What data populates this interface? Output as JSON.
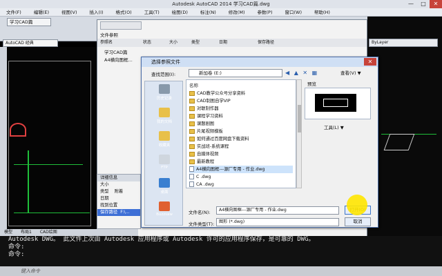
{
  "app": {
    "title": "Autodesk AutoCAD 2014    学习CAD篇.dwg",
    "window_controls": [
      "—",
      "□",
      "✕"
    ]
  },
  "menu": [
    "文件(F)",
    "编辑(E)",
    "视图(V)",
    "插入(I)",
    "格式(O)",
    "工具(T)",
    "绘图(D)",
    "标注(N)",
    "修改(M)",
    "参数(P)",
    "窗口(W)",
    "帮助(H)"
  ],
  "doc_tab": "学习CAD篇",
  "workspace": "AutoCAD 经典",
  "layer_combo": "ByLayer",
  "background_window": {
    "section": "文件参照",
    "columns": [
      "参照名",
      "状态",
      "大小",
      "类型",
      "日期",
      "保存路径"
    ],
    "rows": [
      "学习CAD篇",
      "A4横向图框..."
    ]
  },
  "details": {
    "header": "详细信息",
    "fields": [
      "大小",
      "类型",
      "日期",
      "找到位置",
      "保存路径"
    ],
    "type_value": "附着",
    "path_value": "F:\\..."
  },
  "dialog": {
    "title": "选择参照文件",
    "lookin_label": "查找范围(I):",
    "lookin_value": "新加卷 (E:)",
    "nav_icons": "◀ ▲ ✕ ▦",
    "view_label": "查看(V) ▼",
    "tools_label": "工具(L) ▼",
    "list_header": "名称",
    "preview_label": "预览",
    "places": [
      "历史记录",
      "我的文档",
      "收藏夹",
      "FTP",
      "桌面",
      "Buzzsaw"
    ],
    "files": [
      {
        "name": "CAD教学公众号分享资料",
        "kind": "folder"
      },
      {
        "name": "CAD制图自学VIP",
        "kind": "folder"
      },
      {
        "name": "对联制作器",
        "kind": "folder"
      },
      {
        "name": "课程学习资料",
        "kind": "folder"
      },
      {
        "name": "课题剧图",
        "kind": "folder"
      },
      {
        "name": "片尾视频模板",
        "kind": "folder"
      },
      {
        "name": "如何通过百度网盘下载资料",
        "kind": "folder"
      },
      {
        "name": "实战班-系统课程",
        "kind": "folder"
      },
      {
        "name": "自媒体视频",
        "kind": "folder"
      },
      {
        "name": "最新教程",
        "kind": "folder"
      },
      {
        "name": "A4横向图框---源厂专用 - 作业.dwg",
        "kind": "dwg",
        "selected": true
      },
      {
        "name": "C                .dwg",
        "kind": "dwg"
      },
      {
        "name": "CA                 .dwg",
        "kind": "dwg"
      }
    ],
    "filename_label": "文件名(N):",
    "filename_value": "A4横向图框---源厂专用 - 作业.dwg",
    "filetype_label": "文件类型(T):",
    "filetype_value": "图形 (*.dwg)",
    "open_label": "打开(O)",
    "cancel_label": "取消"
  },
  "model_tabs": [
    "模型",
    "布局1",
    "CAD绘图"
  ],
  "command_lines": [
    "Autodesk DWG。  此文件上次由 Autodesk 应用程序或 Autodesk 许可的应用程序保存，是可靠的 DWG。",
    "命令:",
    "命令:"
  ],
  "command_prompt": "键入命令"
}
